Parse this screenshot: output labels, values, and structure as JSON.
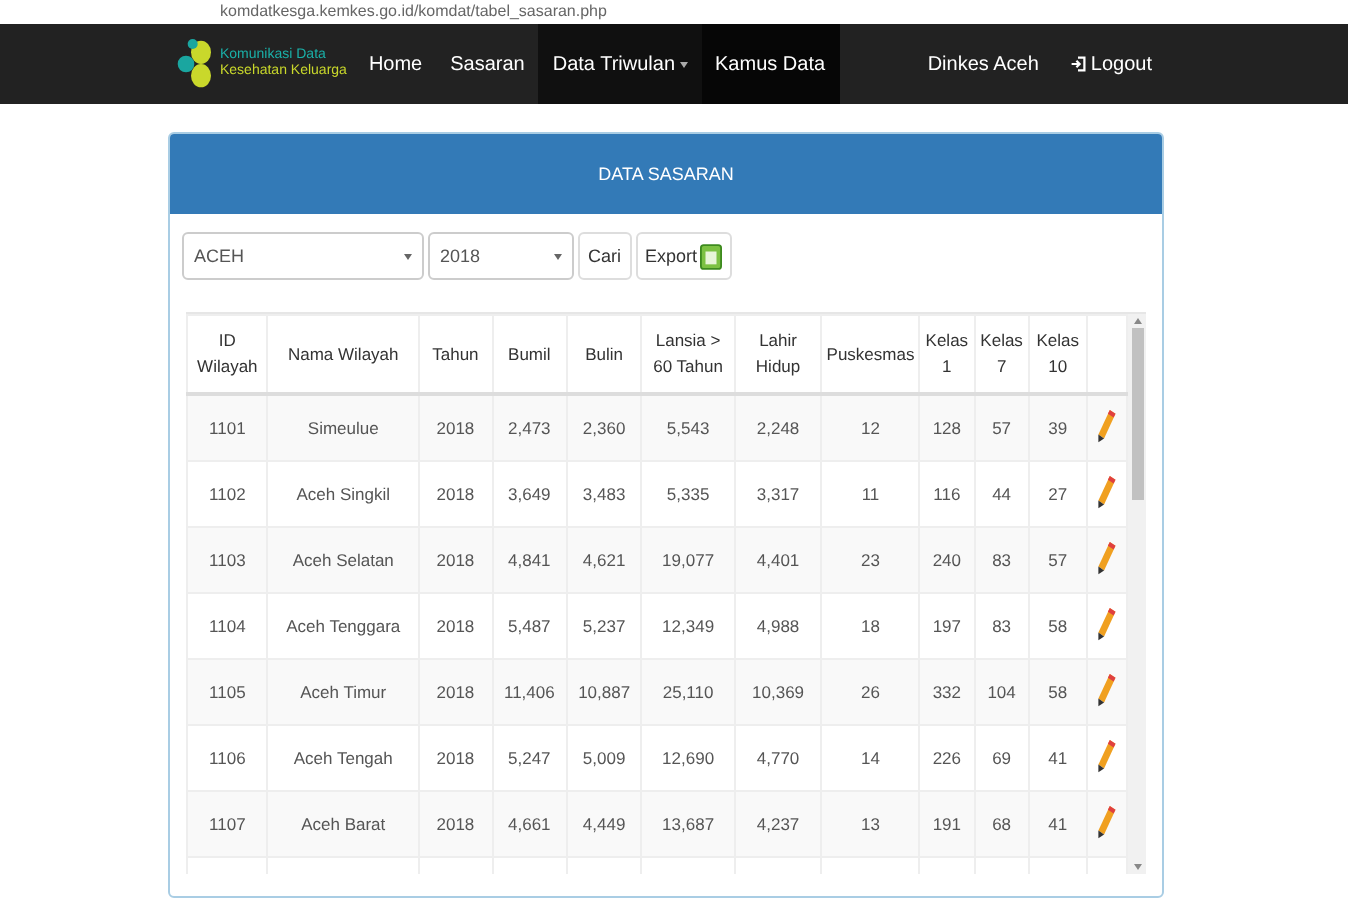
{
  "browser": {
    "url": "komdatkesga.kemkes.go.id/komdat/tabel_sasaran.php"
  },
  "navbar": {
    "brand": [
      "Komunikasi Data",
      "Kesehatan Keluarga"
    ],
    "items": [
      {
        "label": "Home",
        "selected": false,
        "dropdown": false
      },
      {
        "label": "Sasaran",
        "selected": false,
        "dropdown": false
      },
      {
        "label": "Data Triwulan",
        "selected": true,
        "dropdown": true
      },
      {
        "label": "Kamus Data",
        "selected": true,
        "dropdown": false
      }
    ],
    "user": "Dinkes Aceh",
    "logout": "Logout"
  },
  "panel": {
    "title": "DATA SASARAN",
    "filters": {
      "province": "ACEH",
      "year": "2018"
    },
    "buttons": {
      "search": "Cari",
      "export": "Export"
    },
    "table": {
      "columns": [
        "ID Wilayah",
        "Nama Wilayah",
        "Tahun",
        "Bumil",
        "Bulin",
        "Lansia > 60 Tahun",
        "Lahir Hidup",
        "Puskesmas",
        "Kelas 1",
        "Kelas 7",
        "Kelas 10"
      ],
      "rows": [
        [
          "1101",
          "Simeulue",
          "2018",
          "2,473",
          "2,360",
          "5,543",
          "2,248",
          "12",
          "128",
          "57",
          "39"
        ],
        [
          "1102",
          "Aceh Singkil",
          "2018",
          "3,649",
          "3,483",
          "5,335",
          "3,317",
          "11",
          "116",
          "44",
          "27"
        ],
        [
          "1103",
          "Aceh Selatan",
          "2018",
          "4,841",
          "4,621",
          "19,077",
          "4,401",
          "23",
          "240",
          "83",
          "57"
        ],
        [
          "1104",
          "Aceh Tenggara",
          "2018",
          "5,487",
          "5,237",
          "12,349",
          "4,988",
          "18",
          "197",
          "83",
          "58"
        ],
        [
          "1105",
          "Aceh Timur",
          "2018",
          "11,406",
          "10,887",
          "25,110",
          "10,369",
          "26",
          "332",
          "104",
          "58"
        ],
        [
          "1106",
          "Aceh Tengah",
          "2018",
          "5,247",
          "5,009",
          "12,690",
          "4,770",
          "14",
          "226",
          "69",
          "41"
        ],
        [
          "1107",
          "Aceh Barat",
          "2018",
          "4,661",
          "4,449",
          "13,687",
          "4,237",
          "13",
          "191",
          "68",
          "41"
        ]
      ]
    }
  }
}
